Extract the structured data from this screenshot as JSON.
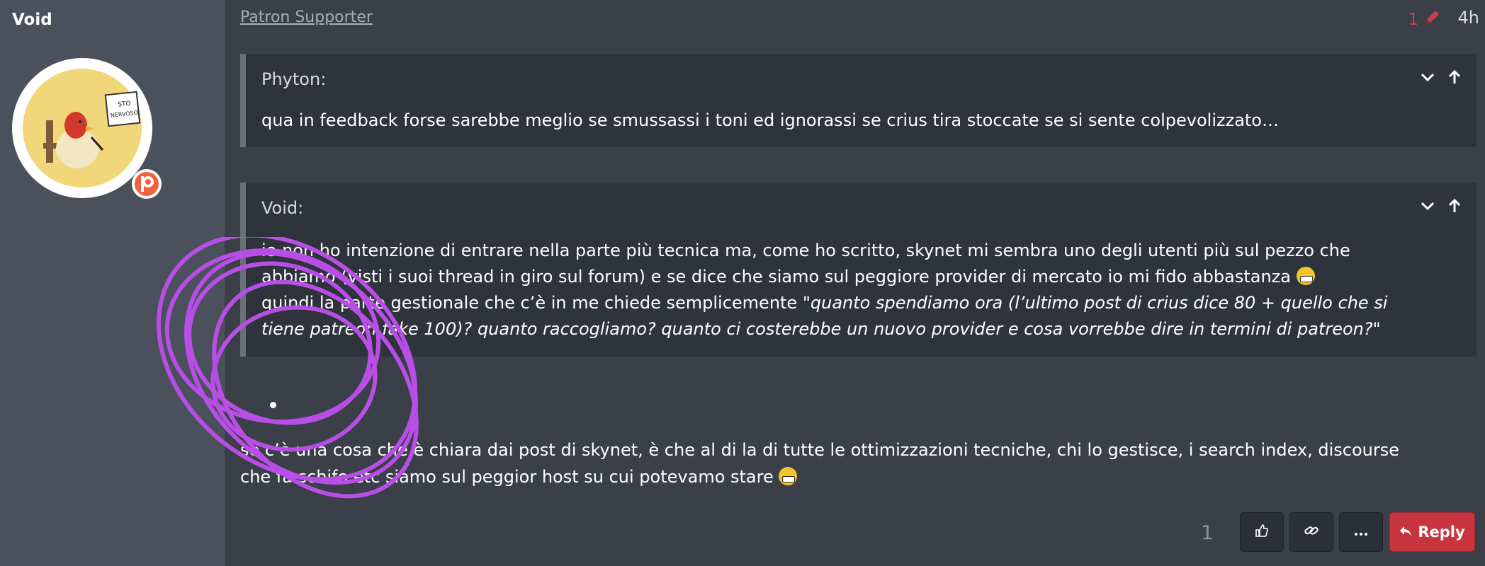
{
  "author": {
    "name": "Void",
    "avatar_sign_text": "STO NERVOSO.",
    "badge": "patreon-icon"
  },
  "post": {
    "user_title": "Patron Supporter",
    "edit_count": "1",
    "age": "4h",
    "quotes": [
      {
        "author": "Phyton:",
        "text": "qua in feedback forse sarebbe meglio se smussassi i toni ed ignorassi se crius tira stoccate se si sente colpevolizzato…"
      },
      {
        "author": "Void:",
        "line1": "io non ho intenzione di entrare nella parte più tecnica ma, come ho scritto, skynet mi sembra uno degli utenti più sul pezzo che",
        "line2": "abbiamo (visti i suoi thread in giro sul forum) e se dice che siamo sul peggiore provider di mercato io mi fido abbastanza",
        "line3_plain": "quindi la parte gestionale che c’è in me chiede semplicemente \"",
        "line3_italic": "quanto spendiamo ora (l’ultimo post di crius dice 80 + quello che si",
        "line4_italic": "tiene patreon fake 100)? quanto raccogliamo? quanto ci costerebbe un nuovo provider e cosa vorrebbe dire in termini di patreon?\""
      }
    ],
    "body_line1": "se c’è una cosa che è chiara dai post di skynet, è che al di la di tutte le ottimizzazioni tecniche, chi lo gestisce, i search index, discourse",
    "body_line2": "che fa schifo etc siamo sul peggior host su cui potevamo stare"
  },
  "footer": {
    "like_count": "1",
    "like_icon": "thumbs-up-icon",
    "link_icon": "link-icon",
    "more_icon": "more-icon",
    "reply_label": "Reply"
  },
  "colors": {
    "accent_red": "#c9353e",
    "scribble": "#b84ee6"
  }
}
